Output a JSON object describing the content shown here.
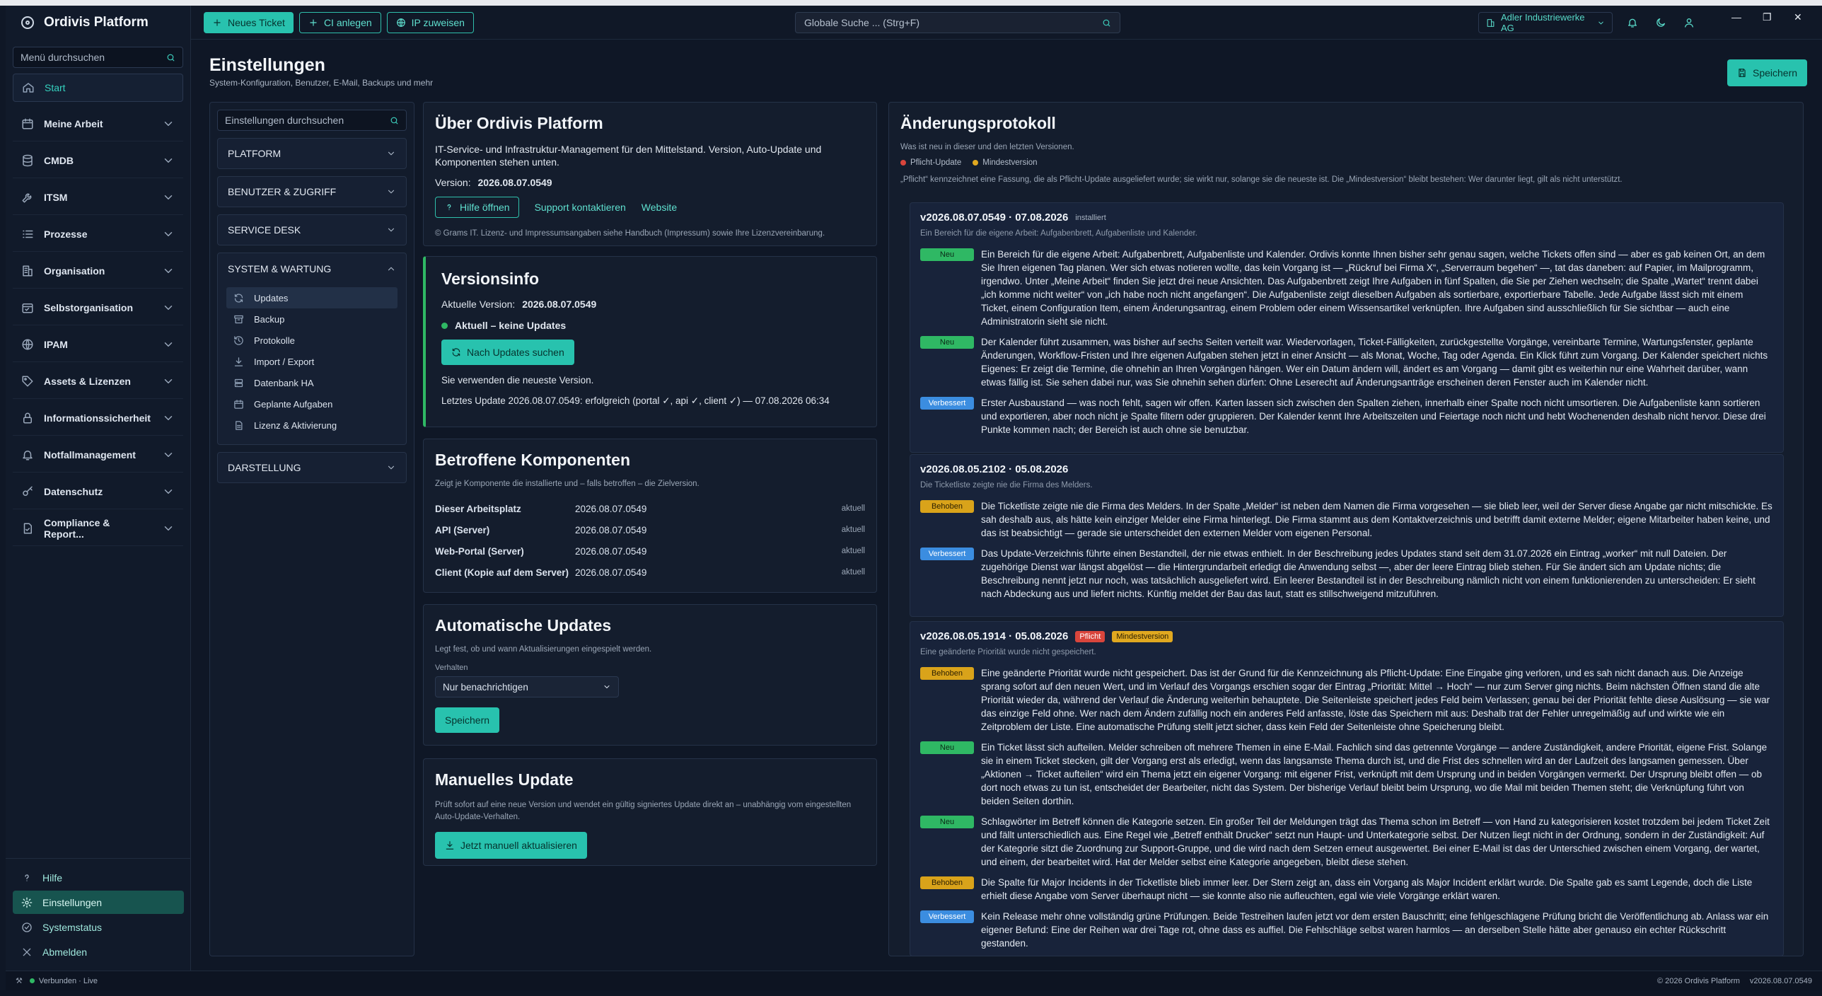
{
  "app": {
    "name": "Ordivis Platform"
  },
  "sidebar": {
    "search_placeholder": "Menü durchsuchen",
    "start": "Start",
    "items": [
      {
        "label": "Meine Arbeit",
        "icon": "calendar-icon"
      },
      {
        "label": "CMDB",
        "icon": "database-icon"
      },
      {
        "label": "ITSM",
        "icon": "wrench-icon"
      },
      {
        "label": "Prozesse",
        "icon": "list-icon"
      },
      {
        "label": "Organisation",
        "icon": "building-icon"
      },
      {
        "label": "Selbstorganisation",
        "icon": "calendar-check-icon"
      },
      {
        "label": "IPAM",
        "icon": "globe-icon"
      },
      {
        "label": "Assets & Lizenzen",
        "icon": "tag-icon"
      },
      {
        "label": "Informationssicherheit",
        "icon": "lock-icon"
      },
      {
        "label": "Notfallmanagement",
        "icon": "bell-icon"
      },
      {
        "label": "Datenschutz",
        "icon": "key-icon"
      },
      {
        "label": "Compliance & Report...",
        "icon": "file-check-icon"
      }
    ],
    "bottom": [
      {
        "label": "Hilfe",
        "icon": "question-icon"
      },
      {
        "label": "Einstellungen",
        "icon": "gear-icon"
      },
      {
        "label": "Systemstatus",
        "icon": "check-circle-icon"
      },
      {
        "label": "Abmelden",
        "icon": "close-icon"
      }
    ]
  },
  "topbar": {
    "new_ticket": "Neues Ticket",
    "ci_anlegen": "CI anlegen",
    "ip_zuweisen": "IP zuweisen",
    "search_placeholder": "Globale Suche ... (Strg+F)",
    "tenant": "Adler Industriewerke AG"
  },
  "page": {
    "title": "Einstellungen",
    "subtitle": "System-Konfiguration, Benutzer, E-Mail, Backups und mehr",
    "save": "Speichern"
  },
  "settings_nav": {
    "search_placeholder": "Einstellungen durchsuchen",
    "sections": [
      "PLATFORM",
      "BENUTZER & ZUGRIFF",
      "SERVICE DESK",
      "SYSTEM & WARTUNG",
      "DARSTELLUNG"
    ],
    "system_items": [
      {
        "label": "Updates",
        "icon": "refresh-icon"
      },
      {
        "label": "Backup",
        "icon": "archive-icon"
      },
      {
        "label": "Protokolle",
        "icon": "history-icon"
      },
      {
        "label": "Import / Export",
        "icon": "download-icon"
      },
      {
        "label": "Datenbank HA",
        "icon": "server-icon"
      },
      {
        "label": "Geplante Aufgaben",
        "icon": "calendar-icon"
      },
      {
        "label": "Lizenz & Aktivierung",
        "icon": "document-icon"
      }
    ]
  },
  "about": {
    "title": "Über Ordivis Platform",
    "desc": "IT-Service- und Infrastruktur-Management für den Mittelstand. Version, Auto-Update und Komponenten stehen unten.",
    "version_label": "Version:",
    "version": "2026.08.07.0549",
    "help": "Hilfe öffnen",
    "support": "Support kontaktieren",
    "website": "Website",
    "legal": "© Grams IT. Lizenz- und Impressumsangaben siehe Handbuch (Impressum) sowie Ihre Lizenzvereinbarung."
  },
  "versioninfo": {
    "title": "Versionsinfo",
    "current_label": "Aktuelle Version:",
    "current": "2026.08.07.0549",
    "status": "Aktuell – keine Updates",
    "check": "Nach Updates suchen",
    "note": "Sie verwenden die neueste Version.",
    "last": "Letztes Update 2026.08.07.0549: erfolgreich (portal ✓, api ✓, client ✓) — 07.08.2026 06:34"
  },
  "components": {
    "title": "Betroffene Komponenten",
    "desc": "Zeigt je Komponente die installierte und – falls betroffen – die Zielversion.",
    "rows": [
      {
        "name": "Dieser Arbeitsplatz",
        "version": "2026.08.07.0549",
        "state": "aktuell"
      },
      {
        "name": "API (Server)",
        "version": "2026.08.07.0549",
        "state": "aktuell"
      },
      {
        "name": "Web-Portal (Server)",
        "version": "2026.08.07.0549",
        "state": "aktuell"
      },
      {
        "name": "Client (Kopie auf dem Server)",
        "version": "2026.08.07.0549",
        "state": "aktuell"
      }
    ]
  },
  "autoupdate": {
    "title": "Automatische Updates",
    "desc": "Legt fest, ob und wann Aktualisierungen eingespielt werden.",
    "label": "Verhalten",
    "value": "Nur benachrichtigen",
    "save": "Speichern"
  },
  "manual": {
    "title": "Manuelles Update",
    "desc": "Prüft sofort auf eine neue Version und wendet ein gültig signiertes Update direkt an – unabhängig vom eingestellten Auto-Update-Verhalten.",
    "button": "Jetzt manuell aktualisieren"
  },
  "changelog": {
    "title": "Änderungsprotokoll",
    "sub": "Was ist neu in dieser und den letzten Versionen.",
    "legend_pf": "Pflicht-Update",
    "legend_mv": "Mindestversion",
    "note": "„Pflicht“ kennzeichnet eine Fassung, die als Pflicht-Update ausgeliefert wurde; sie wirkt nur, solange sie die neueste ist. Die „Mindestversion“ bleibt bestehen: Wer darunter liegt, gilt als nicht unterstützt.",
    "colors": {
      "neu": "#2fb864",
      "verbessert": "#3b8de0",
      "behoben": "#d9a31a",
      "pflicht": "#d9453c",
      "mindest": "#e0a820"
    },
    "entries": [
      {
        "version": "v2026.08.07.0549 · 07.08.2026",
        "tag": "installiert",
        "sub": "Ein Bereich für die eigene Arbeit: Aufgabenbrett, Aufgabenliste und Kalender.",
        "items": [
          {
            "badge": "Neu",
            "text": "Ein Bereich für die eigene Arbeit: Aufgabenbrett, Aufgabenliste und Kalender. Ordivis konnte Ihnen bisher sehr genau sagen, welche Tickets offen sind — aber es gab keinen Ort, an dem Sie Ihren eigenen Tag planen. Wer sich etwas notieren wollte, das kein Vorgang ist — „Rückruf bei Firma X“, „Serverraum begehen“ —, tat das daneben: auf Papier, im Mailprogramm, irgendwo. Unter „Meine Arbeit“ finden Sie jetzt drei neue Ansichten. Das Aufgabenbrett zeigt Ihre Aufgaben in fünf Spalten, die Sie per Ziehen wechseln; die Spalte „Wartet“ trennt dabei „ich komme nicht weiter“ von „ich habe noch nicht angefangen“. Die Aufgabenliste zeigt dieselben Aufgaben als sortierbare, exportierbare Tabelle. Jede Aufgabe lässt sich mit einem Ticket, einem Configuration Item, einem Änderungsantrag, einem Problem oder einem Wissensartikel verknüpfen. Ihre Aufgaben sind ausschließlich für Sie sichtbar — auch eine Administratorin sieht sie nicht."
          },
          {
            "badge": "Neu",
            "text": "Der Kalender führt zusammen, was bisher auf sechs Seiten verteilt war. Wiedervorlagen, Ticket-Fälligkeiten, zurückgestellte Vorgänge, vereinbarte Termine, Wartungsfenster, geplante Änderungen, Workflow-Fristen und Ihre eigenen Aufgaben stehen jetzt in einer Ansicht — als Monat, Woche, Tag oder Agenda. Ein Klick führt zum Vorgang. Der Kalender speichert nichts Eigenes: Er zeigt die Termine, die ohnehin an Ihren Vorgängen hängen. Wer ein Datum ändern will, ändert es am Vorgang — damit gibt es weiterhin nur eine Wahrheit darüber, wann etwas fällig ist. Sie sehen dabei nur, was Sie ohnehin sehen dürfen: Ohne Leserecht auf Änderungsanträge erscheinen deren Fenster auch im Kalender nicht."
          },
          {
            "badge": "Verbessert",
            "text": "Erster Ausbaustand — was noch fehlt, sagen wir offen. Karten lassen sich zwischen den Spalten ziehen, innerhalb einer Spalte noch nicht umsortieren. Die Aufgabenliste kann sortieren und exportieren, aber noch nicht je Spalte filtern oder gruppieren. Der Kalender kennt Ihre Arbeitszeiten und Feiertage noch nicht und hebt Wochenenden deshalb nicht hervor. Diese drei Punkte kommen nach; der Bereich ist auch ohne sie benutzbar."
          }
        ]
      },
      {
        "version": "v2026.08.05.2102 · 05.08.2026",
        "sub": "Die Ticketliste zeigte nie die Firma des Melders.",
        "items": [
          {
            "badge": "Behoben",
            "text": "Die Ticketliste zeigte nie die Firma des Melders. In der Spalte „Melder“ ist neben dem Namen die Firma vorgesehen — sie blieb leer, weil der Server diese Angabe gar nicht mitschickte. Es sah deshalb aus, als hätte kein einziger Melder eine Firma hinterlegt. Die Firma stammt aus dem Kontaktverzeichnis und betrifft damit externe Melder; eigene Mitarbeiter haben keine, und das ist beabsichtigt — gerade sie unterscheidet den externen Melder vom eigenen Personal."
          },
          {
            "badge": "Verbessert",
            "text": "Das Update-Verzeichnis führte einen Bestandteil, der nie etwas enthielt. In der Beschreibung jedes Updates stand seit dem 31.07.2026 ein Eintrag „worker“ mit null Dateien. Der zugehörige Dienst war längst abgelöst — die Hintergrundarbeit erledigt die Anwendung selbst —, aber der leere Eintrag blieb stehen. Für Sie ändert sich am Update nichts; die Beschreibung nennt jetzt nur noch, was tatsächlich ausgeliefert wird. Ein leerer Bestandteil ist in der Beschreibung nämlich nicht von einem funktionierenden zu unterscheiden: Er sieht nach Abdeckung aus und liefert nichts. Künftig meldet der Bau das laut, statt es stillschweigend mitzuführen."
          }
        ]
      },
      {
        "version": "v2026.08.05.1914 · 05.08.2026",
        "pflicht": "Pflicht",
        "mindest": "Mindestversion",
        "sub": "Eine geänderte Priorität wurde nicht gespeichert.",
        "items": [
          {
            "badge": "Behoben",
            "text": "Eine geänderte Priorität wurde nicht gespeichert. Das ist der Grund für die Kennzeichnung als Pflicht-Update: Eine Eingabe ging verloren, und es sah nicht danach aus. Die Anzeige sprang sofort auf den neuen Wert, und im Verlauf des Vorgangs erschien sogar der Eintrag „Priorität: Mittel → Hoch“ — nur zum Server ging nichts. Beim nächsten Öffnen stand die alte Priorität wieder da, während der Verlauf die Änderung weiterhin behauptete. Die Seitenleiste speichert jedes Feld beim Verlassen; genau bei der Priorität fehlte diese Auslösung — sie war das einzige Feld ohne. Wer nach dem Ändern zufällig noch ein anderes Feld anfasste, löste das Speichern mit aus: Deshalb trat der Fehler unregelmäßig auf und wirkte wie ein Zeitproblem der Liste. Eine automatische Prüfung stellt jetzt sicher, dass kein Feld der Seitenleiste ohne Speicherung bleibt."
          },
          {
            "badge": "Neu",
            "text": "Ein Ticket lässt sich aufteilen. Melder schreiben oft mehrere Themen in eine E-Mail. Fachlich sind das getrennte Vorgänge — andere Zuständigkeit, andere Priorität, eigene Frist. Solange sie in einem Ticket stecken, gilt der Vorgang erst als erledigt, wenn das langsamste Thema durch ist, und die Frist des schnellen wird an der Laufzeit des langsamen gemessen. Über „Aktionen → Ticket aufteilen“ wird ein Thema jetzt ein eigener Vorgang: mit eigener Frist, verknüpft mit dem Ursprung und in beiden Vorgängen vermerkt. Der Ursprung bleibt offen — ob dort noch etwas zu tun ist, entscheidet der Bearbeiter, nicht das System. Der bisherige Verlauf bleibt beim Ursprung, wo die Mail mit beiden Themen steht; die Verknüpfung führt von beiden Seiten dorthin."
          },
          {
            "badge": "Neu",
            "text": "Schlagwörter im Betreff können die Kategorie setzen. Ein großer Teil der Meldungen trägt das Thema schon im Betreff — von Hand zu kategorisieren kostet trotzdem bei jedem Ticket Zeit und fällt unterschiedlich aus. Eine Regel wie „Betreff enthält Drucker“ setzt nun Haupt- und Unterkategorie selbst. Der Nutzen liegt nicht in der Ordnung, sondern in der Zuständigkeit: Auf der Kategorie sitzt die Zuordnung zur Support-Gruppe, und die wird nach dem Setzen erneut ausgewertet. Bei einer E-Mail ist das der Unterschied zwischen einem Vorgang, der wartet, und einem, der bearbeitet wird. Hat der Melder selbst eine Kategorie angegeben, bleibt diese stehen."
          },
          {
            "badge": "Behoben",
            "text": "Die Spalte für Major Incidents in der Ticketliste blieb immer leer. Der Stern zeigt an, dass ein Vorgang als Major Incident erklärt wurde. Die Spalte gab es samt Legende, doch die Liste erhielt diese Angabe vom Server überhaupt nicht — sie konnte also nie aufleuchten, egal wie viele Vorgänge erklärt waren."
          },
          {
            "badge": "Verbessert",
            "text": "Kein Release mehr ohne vollständig grüne Prüfungen. Beide Testreihen laufen jetzt vor dem ersten Bauschritt; eine fehlgeschlagene Prüfung bricht die Veröffentlichung ab. Anlass war ein eigener Befund: Eine der Reihen war drei Tage rot, ohne dass es auffiel. Die Fehlschläge selbst waren harmlos — an derselben Stelle hätte aber genauso ein echter Rückschritt gestanden."
          }
        ]
      }
    ]
  },
  "footer": {
    "status": "Verbunden · Live",
    "copyright": "© 2026 Ordivis Platform",
    "version": "v2026.08.07.0549"
  }
}
